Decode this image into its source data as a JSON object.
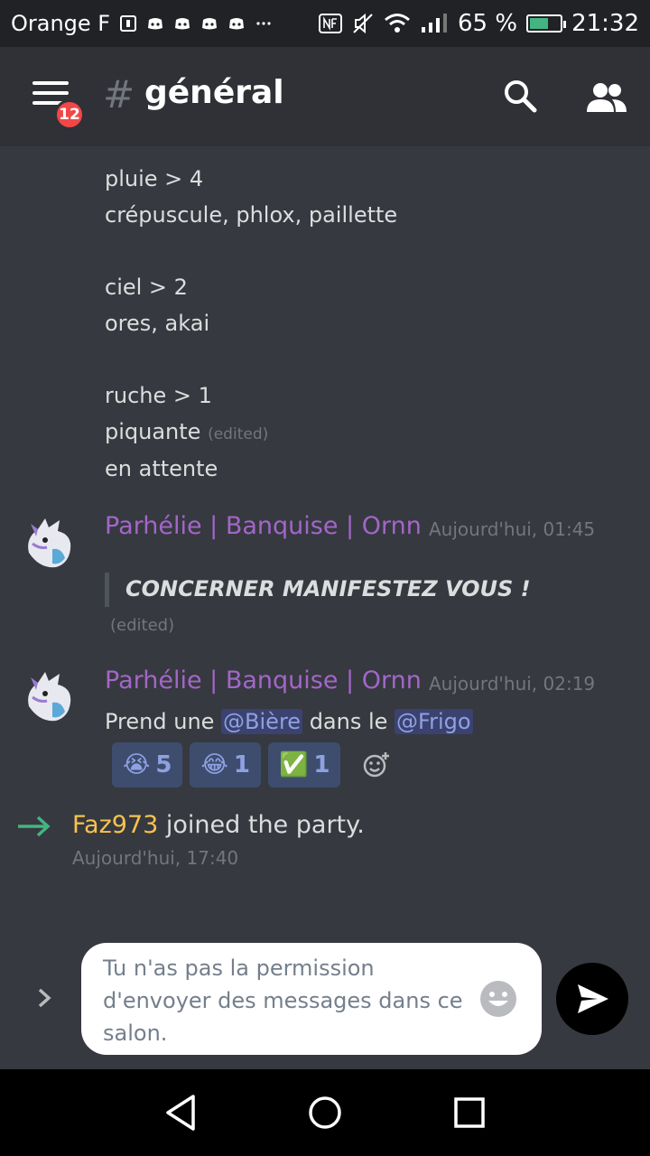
{
  "status_bar": {
    "carrier": "Orange F",
    "battery_percent": "65 %",
    "battery_level": 0.65,
    "time": "21:32"
  },
  "header": {
    "channel_name": "général",
    "unread_badge": "12",
    "hash_symbol": "#"
  },
  "messages_continuation": [
    {
      "text": "pluie > 4"
    },
    {
      "text": "crépuscule, phlox, paillette"
    },
    {
      "text": "ciel > 2"
    },
    {
      "text": "ores, akai"
    },
    {
      "text": "ruche > 1"
    },
    {
      "text": "piquante",
      "edited": "(edited)"
    },
    {
      "text": "en attente"
    }
  ],
  "message1": {
    "author": "Parhélie | Banquise | Ornn",
    "timestamp": "Aujourd'hui, 01:45",
    "quote": "CONCERNER MANIFESTEZ VOUS !",
    "edited": "(edited)"
  },
  "message2": {
    "author": "Parhélie | Banquise | Ornn",
    "timestamp": "Aujourd'hui, 02:19",
    "text_before": "Prend une ",
    "mention1": "@Bière",
    "text_middle": " dans le ",
    "mention2": "@Frigo",
    "reactions": [
      {
        "emoji": "😭",
        "count": "5"
      },
      {
        "emoji": "😂",
        "count": "1"
      },
      {
        "emoji": "✅",
        "count": "1"
      }
    ]
  },
  "join": {
    "username": "Faz973",
    "text": " joined the party.",
    "timestamp": "Aujourd'hui, 17:40"
  },
  "input": {
    "placeholder": "Tu n'as pas la permission d'envoyer des messages dans ce salon."
  },
  "colors": {
    "background": "#36393f",
    "author": "#a366c9",
    "mention": "#8ea1e1",
    "join_user": "#f7c24f",
    "join_arrow": "#43b581",
    "badge": "#f04747"
  }
}
